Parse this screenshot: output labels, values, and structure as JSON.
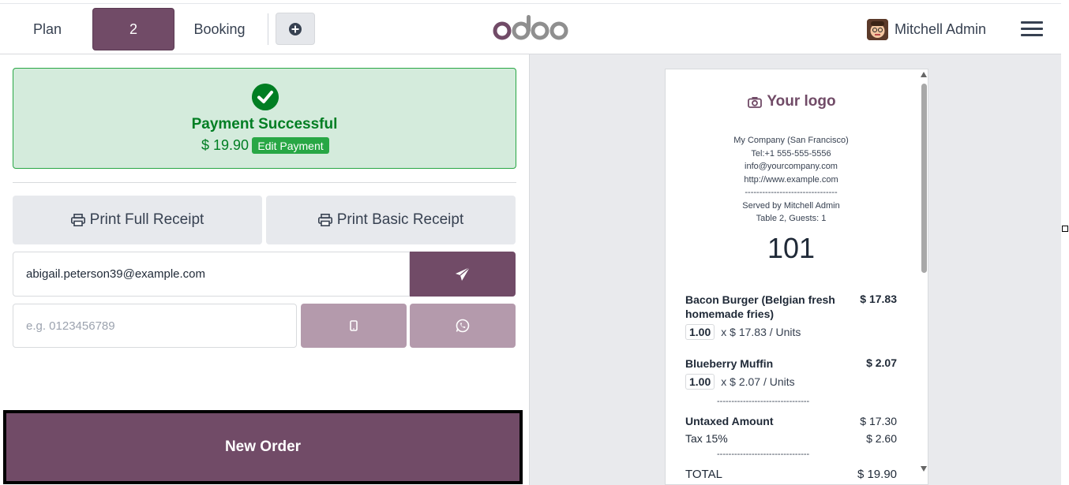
{
  "topbar": {
    "plan_label": "Plan",
    "table_label": "2",
    "booking_label": "Booking",
    "add_icon": "plus-circle-icon",
    "brand": "odoo",
    "user_name": "Mitchell Admin",
    "menu_icon": "hamburger-icon"
  },
  "payment": {
    "status_icon": "check-circle-icon",
    "title": "Payment Successful",
    "amount": "$ 19.90",
    "edit_label": "Edit Payment"
  },
  "actions": {
    "print_full": "Print Full Receipt",
    "print_basic": "Print Basic Receipt",
    "email_value": "abigail.peterson39@example.com",
    "phone_placeholder": "e.g. 0123456789",
    "new_order": "New Order"
  },
  "receipt": {
    "logo_text": "Your logo",
    "company": "My Company (San Francisco)",
    "tel": "Tel:+1 555-555-5556",
    "email": "info@yourcompany.com",
    "website": "http://www.example.com",
    "separator": "--------------------------------",
    "served_by": "Served by Mitchell Admin",
    "table_guests": "Table 2, Guests: 1",
    "order_number": "101",
    "lines": [
      {
        "name": "Bacon Burger (Belgian fresh homemade fries)",
        "price": "$ 17.83",
        "qty": "1.00",
        "unit": "x $ 17.83 / Units"
      },
      {
        "name": "Blueberry Muffin",
        "price": "$ 2.07",
        "qty": "1.00",
        "unit": "x $ 2.07 / Units"
      }
    ],
    "sep2": "--------------------------------",
    "untaxed_label": "Untaxed Amount",
    "untaxed_value": "$ 17.30",
    "tax_label": "Tax 15%",
    "tax_value": "$ 2.60",
    "sep3": "--------------------------------",
    "total_label": "TOTAL",
    "total_value": "$ 19.90"
  }
}
